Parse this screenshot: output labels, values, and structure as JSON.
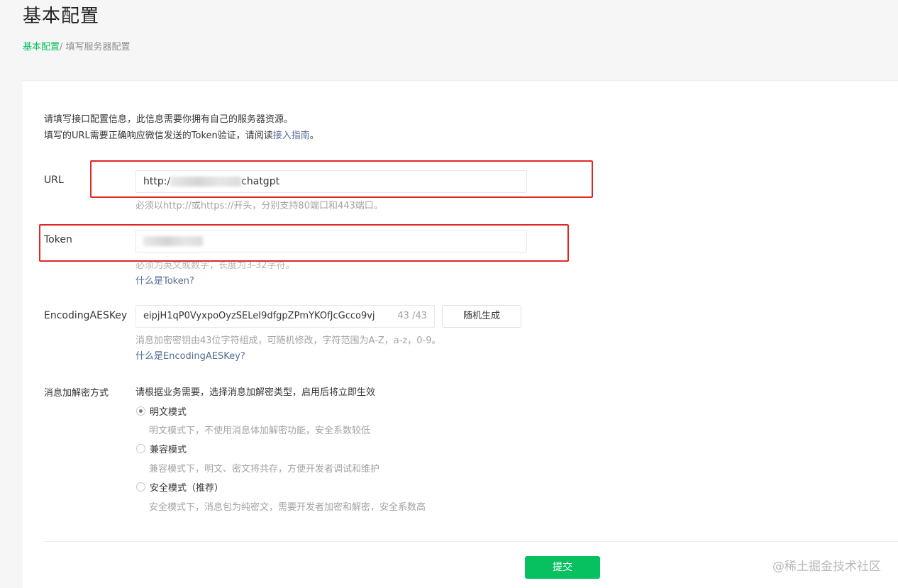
{
  "header": {
    "title": "基本配置",
    "breadcrumb": {
      "link": "基本配置",
      "separator": "/",
      "current": " 填写服务器配置"
    }
  },
  "intro": {
    "line1": "请填写接口配置信息，此信息需要你拥有自己的服务器资源。",
    "line2_prefix": "填写的URL需要正确响应微信发送的Token验证，请阅读",
    "line2_link": "接入指南",
    "line2_suffix": "。"
  },
  "url": {
    "label": "URL",
    "value_prefix": "http:/",
    "value_suffix": "chatgpt",
    "hint": "必须以http://或https://开头，分别支持80端口和443端口。"
  },
  "token": {
    "label": "Token",
    "hint": "必须为英文或数字，长度为3-32字符。",
    "help": "什么是Token?"
  },
  "aes": {
    "label": "EncodingAESKey",
    "value": "eipjH1qP0VyxpoOyzSELeI9dfgpZPmYKOfJcGcco9vj",
    "counter": "43 /43",
    "generate_button": "随机生成",
    "hint": "消息加密密钥由43位字符组成，可随机修改，字符范围为A-Z，a-z，0-9。",
    "help": "什么是EncodingAESKey?"
  },
  "encryption": {
    "label": "消息加解密方式",
    "description": "请根据业务需要，选择消息加解密类型，启用后将立即生效",
    "options": [
      {
        "label": "明文模式",
        "desc": "明文模式下，不使用消息体加解密功能，安全系数较低",
        "checked": true
      },
      {
        "label": "兼容模式",
        "desc": "兼容模式下，明文、密文将共存，方便开发者调试和维护",
        "checked": false
      },
      {
        "label": "安全模式（推荐）",
        "desc": "安全模式下，消息包为纯密文，需要开发者加密和解密，安全系数高",
        "checked": false
      }
    ]
  },
  "submit_label": "提交",
  "watermark": "@稀土掘金技术社区",
  "colors": {
    "brand_green": "#07c160",
    "link_blue": "#576b95",
    "annotation_red": "#e02626"
  }
}
